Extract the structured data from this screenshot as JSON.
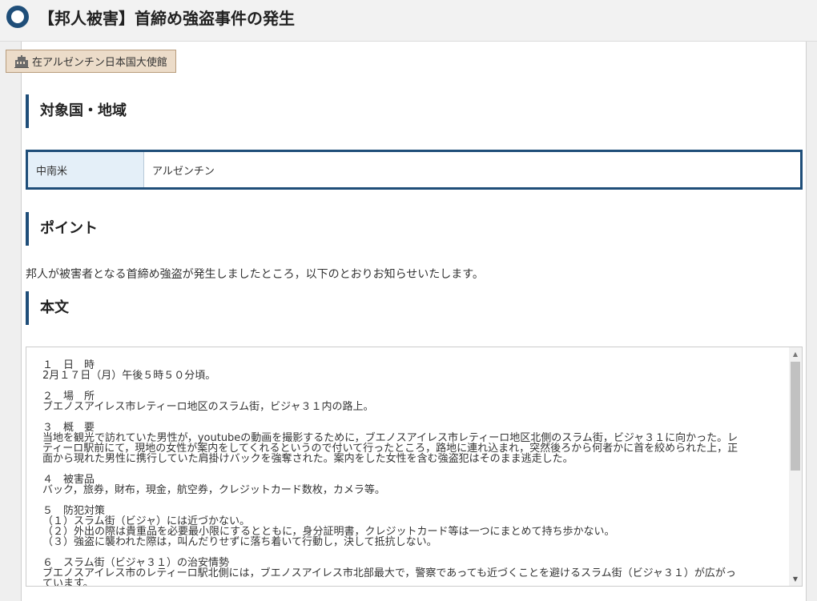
{
  "header": {
    "title": "【邦人被害】首締め強盗事件の発生"
  },
  "source_tag": {
    "label": "在アルゼンチン日本国大使館",
    "icon": "building-icon"
  },
  "sections": {
    "region_heading": "対象国・地域",
    "point_heading": "ポイント",
    "body_heading": "本文"
  },
  "region": {
    "area": "中南米",
    "country": "アルゼンチン"
  },
  "point": {
    "text": "邦人が被害者となる首締め強盗が発生しましたところ，以下のとおりお知らせいたします。"
  },
  "body": {
    "blocks": [
      {
        "lines": [
          "１　日　時",
          "2月１７日（月）午後５時５０分頃。"
        ]
      },
      {
        "lines": [
          "２　場　所",
          "ブエノスアイレス市レティーロ地区のスラム街，ビジャ３１内の路上。"
        ]
      },
      {
        "lines": [
          "３　概　要",
          "当地を観光で訪れていた男性が，youtubeの動画を撮影するために，ブエノスアイレス市レティーロ地区北側のスラム街，ビジャ３１に向かった。レ",
          "ティーロ駅前にて，現地の女性が案内をしてくれるというので付いて行ったところ，路地に連れ込まれ，突然後ろから何者かに首を絞められた上，正",
          "面から現れた男性に携行していた肩掛けバックを強奪された。案内をした女性を含む強盗犯はそのまま逃走した。"
        ]
      },
      {
        "lines": [
          "４　被害品",
          "バック，旅券，財布，現金，航空券，クレジットカード数枚，カメラ等。"
        ]
      },
      {
        "lines": [
          "５　防犯対策",
          "（１）スラム街（ビジャ）には近づかない。",
          "（２）外出の際は貴重品を必要最小限にするとともに，身分証明書，クレジットカード等は一つにまとめて持ち歩かない。",
          "（３）強盗に襲われた際は，叫んだりせずに落ち着いて行動し，決して抵抗しない。"
        ]
      },
      {
        "lines": [
          "６　スラム街（ビジャ３１）の治安情勢",
          "ブエノスアイレス市のレティーロ駅北側には，ブエノスアイレス市北部最大で，警察であっても近づくことを避けるスラム街（ビジャ３１）が広がっ",
          "ています。"
        ]
      }
    ]
  },
  "colors": {
    "accent": "#1f4e79",
    "tag_bg": "#ecdcc9",
    "region_label_bg": "#e4eff8"
  }
}
